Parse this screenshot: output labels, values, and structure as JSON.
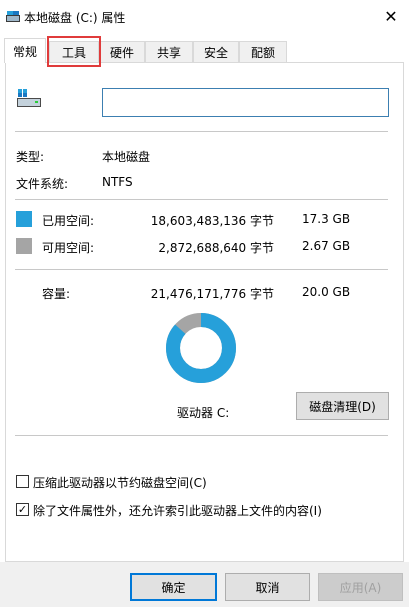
{
  "window": {
    "title": "本地磁盘 (C:) 属性",
    "close_glyph": "✕"
  },
  "tabs": [
    {
      "label": "常规",
      "active": true
    },
    {
      "label": "工具",
      "active": false
    },
    {
      "label": "硬件",
      "active": false
    },
    {
      "label": "共享",
      "active": false
    },
    {
      "label": "安全",
      "active": false
    },
    {
      "label": "配额",
      "active": false
    }
  ],
  "general": {
    "drive_name_value": "",
    "type_label": "类型:",
    "type_value": "本地磁盘",
    "fs_label": "文件系统:",
    "fs_value": "NTFS",
    "used": {
      "label": "已用空间:",
      "bytes": "18,603,483,136 字节",
      "size": "17.3 GB",
      "color": "#26a0da"
    },
    "free": {
      "label": "可用空间:",
      "bytes": "2,872,688,640 字节",
      "size": "2.67 GB",
      "color": "#a5a5a5"
    },
    "capacity": {
      "label": "容量:",
      "bytes": "21,476,171,776 字节",
      "size": "20.0 GB"
    },
    "used_fraction": 0.866,
    "drive_label": "驱动器 C:",
    "cleanup_button": "磁盘清理(D)",
    "compress_checkbox": {
      "label": "压缩此驱动器以节约磁盘空间(C)",
      "checked": false
    },
    "index_checkbox": {
      "label": "除了文件属性外，还允许索引此驱动器上文件的内容(I)",
      "checked": true
    }
  },
  "buttons": {
    "ok": "确定",
    "cancel": "取消",
    "apply": "应用(A)"
  },
  "icons": {
    "title_icon": "drive-icon",
    "drive_icon": "hard-drive-icon"
  }
}
